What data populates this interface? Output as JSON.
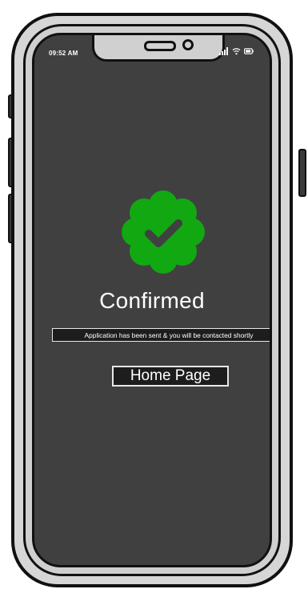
{
  "status_bar": {
    "time": "09:52 AM",
    "icons": [
      "signal-icon",
      "wifi-icon",
      "battery-icon"
    ]
  },
  "confirmation": {
    "icon": "verified-check-badge-icon",
    "title": "Confirmed",
    "message": "Application has been sent & you will be contacted shortly"
  },
  "actions": {
    "home_label": "Home Page"
  },
  "colors": {
    "screen_background": "#404040",
    "badge_green": "#12a812",
    "text": "#ffffff"
  }
}
